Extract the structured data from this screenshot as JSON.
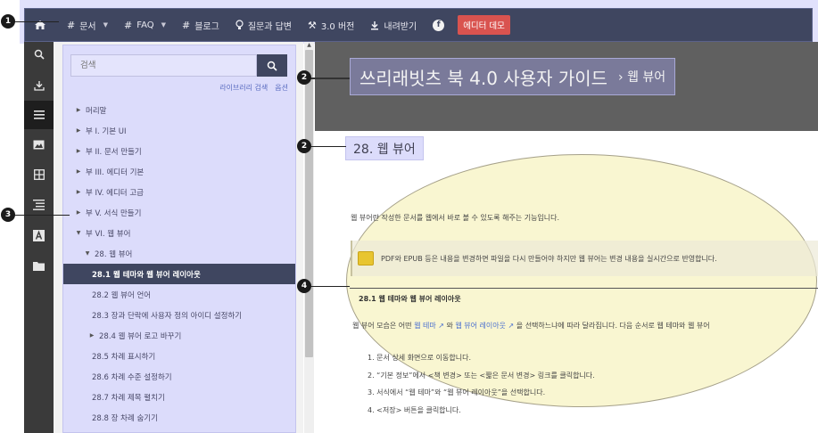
{
  "topnav": {
    "items": [
      {
        "icon": "hash-icon",
        "label": "문서",
        "caret": true
      },
      {
        "icon": "hash-icon",
        "label": "FAQ",
        "caret": true
      },
      {
        "icon": "hash-icon",
        "label": "블로그",
        "caret": false
      },
      {
        "icon": "bulb-icon",
        "label": "질문과 답변",
        "caret": false
      },
      {
        "icon": "tools-icon",
        "label": "3.0 버전",
        "caret": false
      },
      {
        "icon": "download-icon",
        "label": "내려받기",
        "caret": false
      }
    ],
    "demo_button": "에디터 데모"
  },
  "search": {
    "placeholder": "검색",
    "library_search": "라이브러리 검색",
    "options": "옵션"
  },
  "toc": [
    {
      "label": "머리말",
      "arrow": "right",
      "indent": 0,
      "active": false
    },
    {
      "label": "부 I. 기본 UI",
      "arrow": "right",
      "indent": 0,
      "active": false
    },
    {
      "label": "부 II. 문서 만들기",
      "arrow": "right",
      "indent": 0,
      "active": false
    },
    {
      "label": "부 III. 에디터 기본",
      "arrow": "right",
      "indent": 0,
      "active": false
    },
    {
      "label": "부 IV. 에디터 고급",
      "arrow": "right",
      "indent": 0,
      "active": false
    },
    {
      "label": "부 V. 서식 만들기",
      "arrow": "right",
      "indent": 0,
      "active": false
    },
    {
      "label": "부 VI. 웹 뷰어",
      "arrow": "down",
      "indent": 0,
      "active": false
    },
    {
      "label": "28. 웹 뷰어",
      "arrow": "down",
      "indent": 1,
      "active": false
    },
    {
      "label": "28.1 웹 테마와 웹 뷰어 레이아웃",
      "arrow": "none",
      "indent": 2,
      "active": true
    },
    {
      "label": "28.2 웹 뷰어 언어",
      "arrow": "none",
      "indent": 2,
      "active": false
    },
    {
      "label": "28.3 장과 단락에 사용자 정의 아이디 설정하기",
      "arrow": "none",
      "indent": 2,
      "active": false
    },
    {
      "label": "28.4 웹 뷰어 로고 바꾸기",
      "arrow": "right",
      "indent": 1.5,
      "active": false
    },
    {
      "label": "28.5 차례 표시하기",
      "arrow": "none",
      "indent": 2,
      "active": false
    },
    {
      "label": "28.6 차례 수준 설정하기",
      "arrow": "none",
      "indent": 2,
      "active": false
    },
    {
      "label": "28.7 차례 제목 펼치기",
      "arrow": "none",
      "indent": 2,
      "active": false
    },
    {
      "label": "28.8 장 차례 숨기기",
      "arrow": "none",
      "indent": 2,
      "active": false
    }
  ],
  "banner": {
    "title": "쓰리래빗츠 북 4.0 사용자 가이드",
    "subtitle": "› 웹 뷰어"
  },
  "chapter_title": "28. 웹 뷰어",
  "content": {
    "intro": "웹 뷰어란 작성한 문서를 웹에서 바로 볼 수 있도록 해주는 기능입니다.",
    "note": "PDF와 EPUB 등은 내용을 변경하면 파일을 다시 만들어야 하지만 웹 뷰어는 변경 내용을 실시간으로 반영합니다.",
    "section_title": "28.1 웹 테마와 웹 뷰어 레이아웃",
    "section_p_pre": "웹 뷰어 모습은 어떤 ",
    "link1": "웹 테마",
    "section_p_mid": " 와 ",
    "link2": "웹 뷰어 레이아웃",
    "section_p_post": " 을 선택하느냐에 따라 달라집니다. 다음 순서로 웹 테마와 웹 뷰어",
    "steps": [
      "1. 문서 상세 화면으로 이동합니다.",
      "2. “기본 정보”에서 <책 변경> 또는 <짧은 문서 변경> 링크를 클릭합니다.",
      "3. 서식에서 “웹 테마”와 “웹 뷰어 레이아웃”을 선택합니다.",
      "4. <저장> 버튼을 클릭합니다."
    ]
  },
  "callouts": [
    "1",
    "2",
    "2",
    "3",
    "4"
  ],
  "colors": {
    "topbar": "#3f4660",
    "highlight": "#dcdcfb",
    "demo_button": "#d9534f",
    "ellipse": "#f6f2be",
    "link": "#4a6fd0"
  }
}
